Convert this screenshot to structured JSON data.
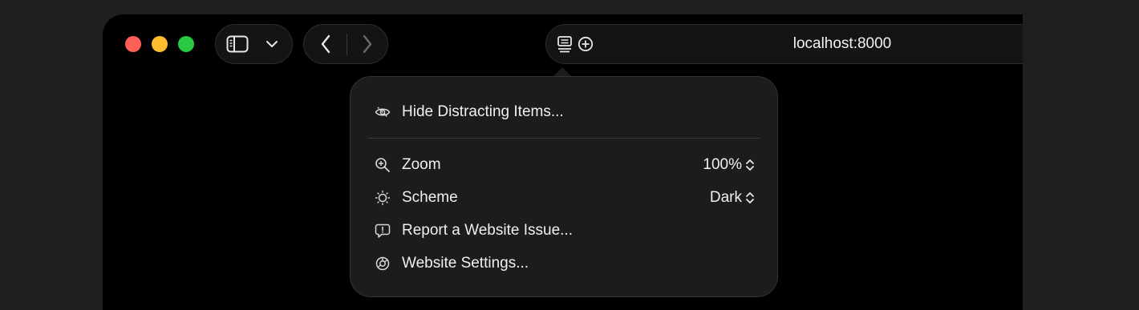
{
  "toolbar": {
    "url": "localhost:8000"
  },
  "menu": {
    "hide_distracting": "Hide Distracting Items...",
    "zoom_label": "Zoom",
    "zoom_value": "100%",
    "scheme_label": "Scheme",
    "scheme_value": "Dark",
    "report_issue": "Report a Website Issue...",
    "website_settings": "Website Settings..."
  },
  "colors": {
    "close": "#fe5f57",
    "minimize": "#febc2e",
    "zoom": "#28c840"
  }
}
